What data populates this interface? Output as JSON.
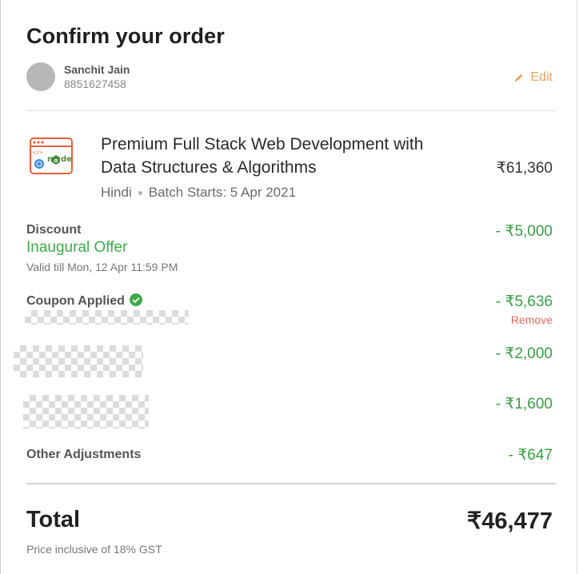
{
  "header": {
    "title": "Confirm your order"
  },
  "user": {
    "name": "Sanchit Jain",
    "phone": "8851627458",
    "edit_label": "Edit"
  },
  "course": {
    "title": "Premium Full Stack Web Development with Data Structures & Algorithms",
    "language": "Hindi",
    "batch_starts": "Batch Starts: 5 Apr 2021",
    "price": "₹61,360",
    "icon": "node-course-icon"
  },
  "discount": {
    "label": "Discount",
    "offer_name": "Inaugural Offer",
    "valid_till": "Valid till Mon, 12 Apr 11:59 PM",
    "amount": "- ₹5,000"
  },
  "coupon": {
    "label": "Coupon Applied",
    "amount": "- ₹5,636",
    "remove_label": "Remove",
    "status_icon": "check-circle-icon"
  },
  "redacted_items": [
    {
      "amount": "- ₹2,000"
    },
    {
      "amount": "- ₹1,600"
    }
  ],
  "adjustments": {
    "label": "Other Adjustments",
    "amount": "- ₹647"
  },
  "total": {
    "label": "Total",
    "value": "₹46,477",
    "note": "Price inclusive of 18% GST"
  },
  "colors": {
    "accent_orange": "#f0a060",
    "discount_green": "#3b9c47",
    "remove_red": "#e86a5c"
  }
}
